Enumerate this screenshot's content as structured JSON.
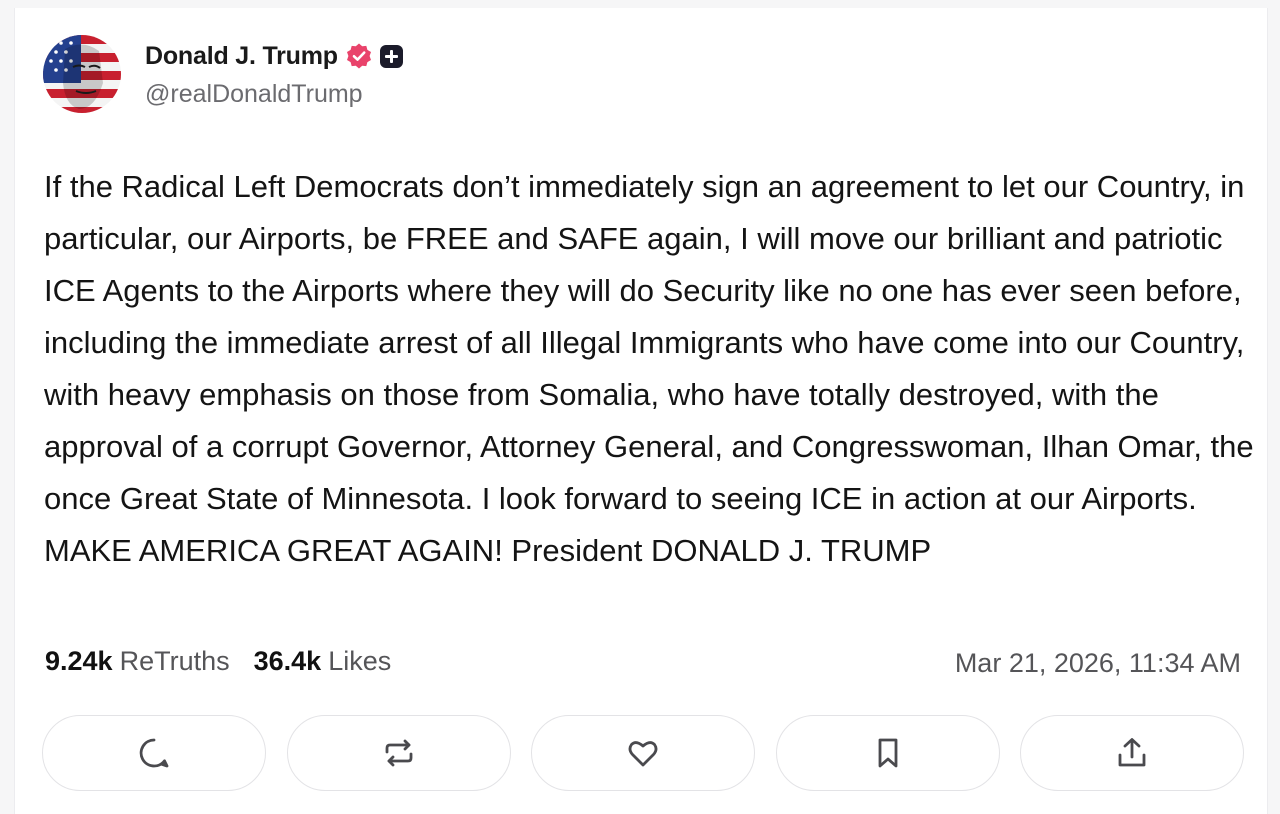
{
  "post": {
    "author": {
      "display_name": "Donald J. Trump",
      "handle": "@realDonaldTrump",
      "verified_icon": "verified-badge-icon",
      "badge_icon": "plus-badge-icon",
      "avatar_icon": "american-flag-face-avatar"
    },
    "text": "If the Radical Left Democrats don’t immediately sign an agreement to let our Country, in particular, our Airports, be FREE and SAFE again, I will move our brilliant and patriotic ICE Agents to the Airports where they will do Security like no one has ever seen before, including the immediate arrest of all Illegal Immigrants who have come into our Country, with heavy emphasis on those from Somalia, who have totally destroyed, with the approval of a corrupt Governor, Attorney General, and Congresswoman, Ilhan Omar, the once Great State of Minnesota. I look forward to seeing ICE in action at our Airports. MAKE AMERICA GREAT AGAIN! President DONALD J. TRUMP",
    "stats": {
      "retruths_count": "9.24k",
      "retruths_label": "ReTruths",
      "likes_count": "36.4k",
      "likes_label": "Likes"
    },
    "timestamp": "Mar 21, 2026, 11:34 AM"
  },
  "actions": [
    {
      "icon": "reply-icon"
    },
    {
      "icon": "retruth-icon"
    },
    {
      "icon": "like-heart-icon"
    },
    {
      "icon": "bookmark-icon"
    },
    {
      "icon": "share-icon"
    }
  ],
  "colors": {
    "verified_badge": "#e9436b",
    "icon_stroke": "#4a4a4e",
    "text": "#141414",
    "muted": "#555558"
  }
}
